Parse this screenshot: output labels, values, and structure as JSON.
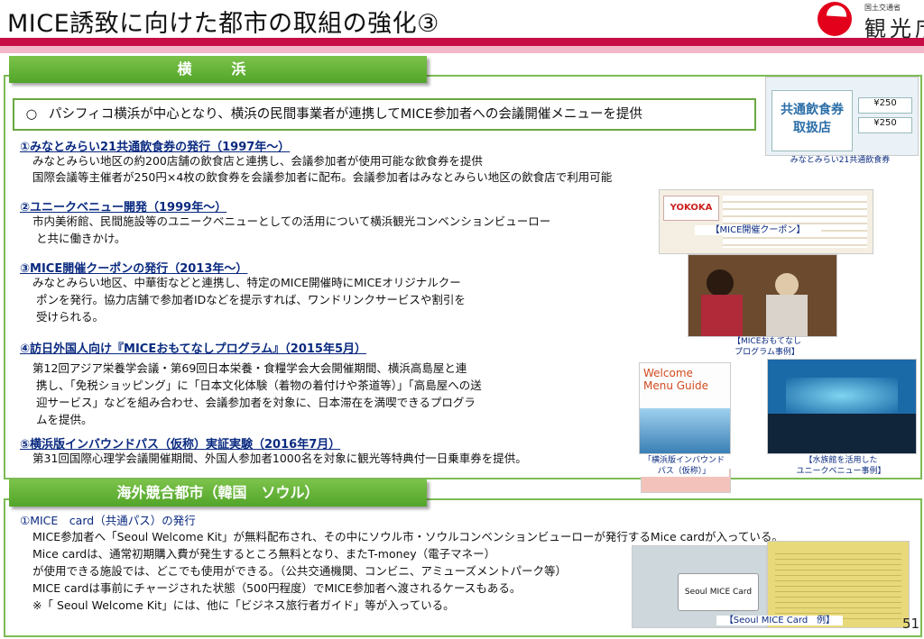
{
  "header": {
    "title": "MICE誘致に向けた都市の取組の強化③",
    "logo_small": "国土交通省",
    "logo_main": "観光庁"
  },
  "yokohama": {
    "tab_label": "横　浜",
    "summary_bullet": "○",
    "summary": "パシフィコ横浜が中心となり、横浜の民間事業者が連携してMICE参加者への会議開催メニューを提供",
    "items": [
      {
        "heading": "①みなとみらい21共通飲食券の発行（1997年～）",
        "lines": [
          "みなとみらい地区の約200店舗の飲食店と連携し、会議参加者が使用可能な飲食券を提供",
          "国際会議等主催者が250円×4枚の飲食券を会議参加者に配布。会議参加者はみなとみらい地区の飲食店で利用可能"
        ]
      },
      {
        "heading": "②ユニークベニュー開発（1999年～）",
        "lines": [
          "市内美術館、民間施設等のユニークベニューとしての活用について横浜観光コンベンションビューロー",
          "と共に働きかけ。"
        ]
      },
      {
        "heading": "③MICE開催クーポンの発行（2013年～）",
        "lines": [
          "みなとみらい地区、中華街などと連携し、特定のMICE開催時にMICEオリジナルクー",
          "ポンを発行。協力店舗で参加者IDなどを提示すれば、ワンドリンクサービスや割引を",
          "受けられる。"
        ]
      },
      {
        "heading": "④訪日外国人向け『MICEおもてなしプログラム』（2015年5月）",
        "lines": [
          "第12回アジア栄養学会議・第69回日本栄養・食糧学会大会開催期間、横浜高島屋と連",
          "携し、「免税ショッピング」に「日本文化体験（着物の着付けや茶道等）」「高島屋への送",
          "迎サービス」などを組み合わせ、会議参加者を対象に、日本滞在を満喫できるプログラ",
          "ムを提供。"
        ]
      },
      {
        "heading": "⑤横浜版インバウンドパス（仮称）実証実験（2016年7月）",
        "lines": [
          "第31回国際心理学会議開催期間、外国人参加者1000名を対象に観光等特典付一日乗車券を提供。"
        ]
      }
    ],
    "captions": {
      "meal": "みなとみらい21共通飲食券",
      "coupon": "【MICE開催クーポン】",
      "kimono_1": "【MICEおもてなし",
      "kimono_2": "プログラム事例】",
      "guide_1": "「横浜版インバウンド",
      "guide_2": "パス（仮称）」",
      "aquarium_1": "【水族館を活用した",
      "aquarium_2": "ユニークベニュー事例】"
    },
    "photo_text": {
      "meal_1": "共通飲食券",
      "meal_2": "取扱店",
      "meal_price": "¥250",
      "coupon_logo": "YOKOKA",
      "guide_title_1": "Welcome",
      "guide_title_2": "Menu Guide"
    }
  },
  "seoul": {
    "tab_label": "海外競合都市（韓国　ソウル）",
    "heading": "①MICE　card（共通パス）の発行",
    "lines": [
      "MICE参加者へ「Seoul Welcome Kit」が無料配布され、その中にソウル市・ソウルコンベンションビューローが発行するMice cardが入っている。",
      "Mice cardは、通常初期購入費が発生するところ無料となり、またT-money（電子マネー）",
      "が使用できる施設では、どこでも使用ができる。（公共交通機関、コンビニ、アミューズメントパーク等）",
      "MICE cardは事前にチャージされた状態（500円程度）でMICE参加者へ渡されるケースもある。",
      "※「 Seoul Welcome Kit」には、他に「ビジネス旅行者ガイド」等が入っている。"
    ],
    "caption": "【Seoul MICE Card　例】",
    "card_text": "Seoul MICE Card"
  },
  "page_number": "51",
  "colors": {
    "title_bar": "#c70d45",
    "section_green": "#52a52a",
    "heading_blue": "#0a2a80"
  }
}
